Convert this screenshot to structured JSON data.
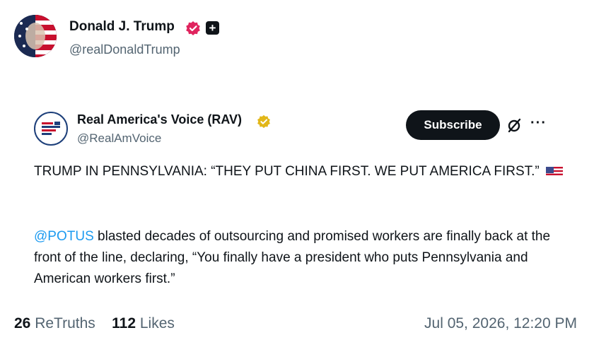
{
  "author": {
    "display_name": "Donald J. Trump",
    "handle": "@realDonaldTrump",
    "verified_badge_color": "#e0245e"
  },
  "quoted_post": {
    "display_name": "Real America's Voice (RAV)",
    "handle": "@RealAmVoice",
    "verified_badge_color": "#e2b719",
    "subscribe_label": "Subscribe",
    "more_label": "···",
    "headline": "TRUMP IN PENNSYLVANIA: “THEY PUT CHINA FIRST. WE PUT AMERICA FIRST.”",
    "body_mention": "@POTUS",
    "body_text": " blasted decades of outsourcing and promised workers are finally back at the front of the line, declaring, “You finally have a president who puts Pennsylvania and American workers first.”"
  },
  "stats": {
    "retruths_count": "26",
    "retruths_label": "ReTruths",
    "likes_count": "112",
    "likes_label": "Likes"
  },
  "timestamp": "Jul 05, 2026, 12:20 PM",
  "colors": {
    "mention": "#1d9bf0",
    "text": "#0f1419",
    "muted": "#536471"
  }
}
